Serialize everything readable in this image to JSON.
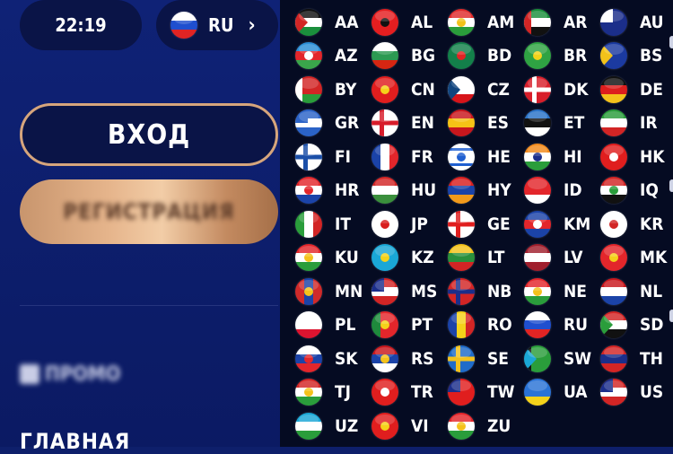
{
  "header": {
    "time": "22:19",
    "current_lang": {
      "code": "RU",
      "stripes": [
        "#ffffff",
        "#1f4fcf",
        "#e12424"
      ]
    }
  },
  "auth": {
    "login_label": "ВХОД",
    "register_label": "РЕГИСТРАЦИЯ"
  },
  "menu": {
    "promo_label": "ПРОМО",
    "home_label": "ГЛАВНАЯ"
  },
  "colors": {
    "sidebar": "#0f2276",
    "panel": "#050b22",
    "accent": "#d6a57c",
    "pill": "#0a1447"
  },
  "languages": [
    {
      "code": "AA",
      "stripes": [
        "#111111",
        "#ffffff",
        "#1a8f3c"
      ],
      "tri": "#d22525"
    },
    {
      "code": "AL",
      "solid": "#e41e20",
      "dot": "#111111"
    },
    {
      "code": "AM",
      "stripes": [
        "#e02b2b",
        "#ffffff",
        "#2a9d3b"
      ],
      "dot": "#f2c21a"
    },
    {
      "code": "AR",
      "stripes": [
        "#1a8f3c",
        "#ffffff",
        "#111111"
      ],
      "bar": "#d22525"
    },
    {
      "code": "AU",
      "solid": "#1b2e8a",
      "canton": "#ffffff"
    },
    {
      "code": "AZ",
      "stripes": [
        "#2b8ed6",
        "#e3262b",
        "#3aa64b"
      ],
      "dot": "#ffffff"
    },
    {
      "code": "BG",
      "stripes": [
        "#ffffff",
        "#2c9a52",
        "#d62612"
      ]
    },
    {
      "code": "BD",
      "solid": "#13804a",
      "dot": "#e02424"
    },
    {
      "code": "BR",
      "solid": "#2fa343",
      "dot": "#f3d31a"
    },
    {
      "code": "BS",
      "solid": "#1b3aa0",
      "tri": "#f2c21a"
    },
    {
      "code": "BY",
      "stripes": [
        "#d22525",
        "#d22525",
        "#2a9d3b"
      ],
      "bar": "#ffffff"
    },
    {
      "code": "CN",
      "solid": "#e01e1e",
      "dot": "#f5d21a"
    },
    {
      "code": "CZ",
      "stripes": [
        "#ffffff",
        "#ffffff",
        "#d7141a"
      ],
      "tri": "#11457e"
    },
    {
      "code": "DK",
      "solid": "#d81e2a",
      "cross": "#ffffff"
    },
    {
      "code": "DE",
      "stripes": [
        "#111111",
        "#dd1e1e",
        "#f4c21b"
      ]
    },
    {
      "code": "GR",
      "stripes": [
        "#2b63c7",
        "#ffffff",
        "#2b63c7"
      ],
      "canton": "#2b63c7"
    },
    {
      "code": "EN",
      "solid": "#ffffff",
      "cross": "#d71c2a"
    },
    {
      "code": "ES",
      "stripes": [
        "#c8171d",
        "#f5c316",
        "#c8171d"
      ]
    },
    {
      "code": "ET",
      "stripes": [
        "#2a73c9",
        "#111111",
        "#ffffff"
      ]
    },
    {
      "code": "IR",
      "stripes": [
        "#2a9d3b",
        "#ffffff",
        "#d22525"
      ]
    },
    {
      "code": "FI",
      "solid": "#ffffff",
      "cross": "#1b4fa8"
    },
    {
      "code": "FR",
      "vstripes": [
        "#1b43a8",
        "#ffffff",
        "#e3262b"
      ]
    },
    {
      "code": "HE",
      "solid": "#ffffff",
      "hbands": "#1f5fd0",
      "dot": "#1f5fd0"
    },
    {
      "code": "HI",
      "stripes": [
        "#f28a1c",
        "#ffffff",
        "#2a9d3b"
      ],
      "dot": "#1b2e8a"
    },
    {
      "code": "HK",
      "solid": "#e01e1e",
      "dot": "#ffffff"
    },
    {
      "code": "HR",
      "stripes": [
        "#e3262b",
        "#ffffff",
        "#1b43a8"
      ],
      "dot": "#e3262b"
    },
    {
      "code": "HU",
      "stripes": [
        "#d22525",
        "#ffffff",
        "#3a8f3c"
      ]
    },
    {
      "code": "HY",
      "stripes": [
        "#d81e1e",
        "#1b43a8",
        "#f29a1b"
      ]
    },
    {
      "code": "ID",
      "stripes": [
        "#e3262b",
        "#e3262b",
        "#ffffff"
      ]
    },
    {
      "code": "IQ",
      "stripes": [
        "#d22525",
        "#ffffff",
        "#111111"
      ],
      "dot": "#2a9d3b"
    },
    {
      "code": "IT",
      "vstripes": [
        "#2a9d3b",
        "#ffffff",
        "#d22525"
      ]
    },
    {
      "code": "JP",
      "solid": "#ffffff",
      "dot": "#d81e1e"
    },
    {
      "code": "GE",
      "solid": "#ffffff",
      "cross": "#e01e1e"
    },
    {
      "code": "KM",
      "stripes": [
        "#1b43a8",
        "#e3262b",
        "#1b43a8"
      ],
      "dot": "#ffffff"
    },
    {
      "code": "KR",
      "solid": "#ffffff",
      "dot": "#d22525"
    },
    {
      "code": "KU",
      "stripes": [
        "#e3262b",
        "#ffffff",
        "#2a9d3b"
      ],
      "dot": "#f4c21b"
    },
    {
      "code": "KZ",
      "solid": "#1aa7d6",
      "dot": "#f4d21a"
    },
    {
      "code": "LT",
      "stripes": [
        "#f4c21b",
        "#2a8f3c",
        "#d22525"
      ]
    },
    {
      "code": "LV",
      "stripes": [
        "#a01f2d",
        "#ffffff",
        "#a01f2d"
      ]
    },
    {
      "code": "MK",
      "solid": "#e3262b",
      "dot": "#f4d21a"
    },
    {
      "code": "MN",
      "vstripes": [
        "#cf2a2a",
        "#1b43a8",
        "#cf2a2a"
      ],
      "dot": "#f4c21b"
    },
    {
      "code": "MS",
      "stripes": [
        "#d22525",
        "#ffffff",
        "#d22525"
      ],
      "canton": "#1b2e8a"
    },
    {
      "code": "NB",
      "solid": "#d22525",
      "cross": "#1b2e8a"
    },
    {
      "code": "NE",
      "stripes": [
        "#e3262b",
        "#ffffff",
        "#2a9d3b"
      ],
      "dot": "#f4c21b"
    },
    {
      "code": "NL",
      "stripes": [
        "#c8171d",
        "#ffffff",
        "#1b43a8"
      ]
    },
    {
      "code": "PL",
      "stripes": [
        "#ffffff",
        "#ffffff",
        "#dc1430"
      ]
    },
    {
      "code": "PT",
      "vstripes": [
        "#1f8a3c",
        "#e3262b",
        "#e3262b"
      ],
      "dot": "#f4d21a"
    },
    {
      "code": "RO",
      "vstripes": [
        "#1b43a8",
        "#f4d21a",
        "#d22525"
      ]
    },
    {
      "code": "RU",
      "stripes": [
        "#ffffff",
        "#1f4fcf",
        "#e12424"
      ]
    },
    {
      "code": "SD",
      "stripes": [
        "#d22525",
        "#ffffff",
        "#111111"
      ],
      "tri": "#2a9d3b"
    },
    {
      "code": "SK",
      "stripes": [
        "#ffffff",
        "#1b43a8",
        "#e3262b"
      ],
      "dot": "#e3262b"
    },
    {
      "code": "RS",
      "stripes": [
        "#c8171d",
        "#1b43a8",
        "#ffffff"
      ],
      "dot": "#f4c21b"
    },
    {
      "code": "SE",
      "solid": "#1f6bc9",
      "cross": "#f4c21b"
    },
    {
      "code": "SW",
      "solid": "#2a9d3b",
      "tri": "#1aa7d6",
      "bar": "#111111"
    },
    {
      "code": "TH",
      "stripes": [
        "#d22525",
        "#1b2e8a",
        "#d22525"
      ]
    },
    {
      "code": "TJ",
      "stripes": [
        "#d22525",
        "#ffffff",
        "#2a9d3b"
      ],
      "dot": "#f4c21b"
    },
    {
      "code": "TR",
      "solid": "#e01e1e",
      "dot": "#ffffff"
    },
    {
      "code": "TW",
      "solid": "#e01e1e",
      "canton": "#1b2e8a"
    },
    {
      "code": "UA",
      "stripes": [
        "#2a73d6",
        "#2a73d6",
        "#f4d21a"
      ]
    },
    {
      "code": "US",
      "stripes": [
        "#d22525",
        "#ffffff",
        "#d22525"
      ],
      "canton": "#1b2e8a"
    },
    {
      "code": "UZ",
      "stripes": [
        "#1aa7d6",
        "#ffffff",
        "#2a9d3b"
      ]
    },
    {
      "code": "VI",
      "solid": "#e01e1e",
      "dot": "#f5d21a"
    },
    {
      "code": "ZU",
      "stripes": [
        "#e3262b",
        "#ffffff",
        "#2a9d3b"
      ],
      "dot": "#f4c21b"
    }
  ]
}
